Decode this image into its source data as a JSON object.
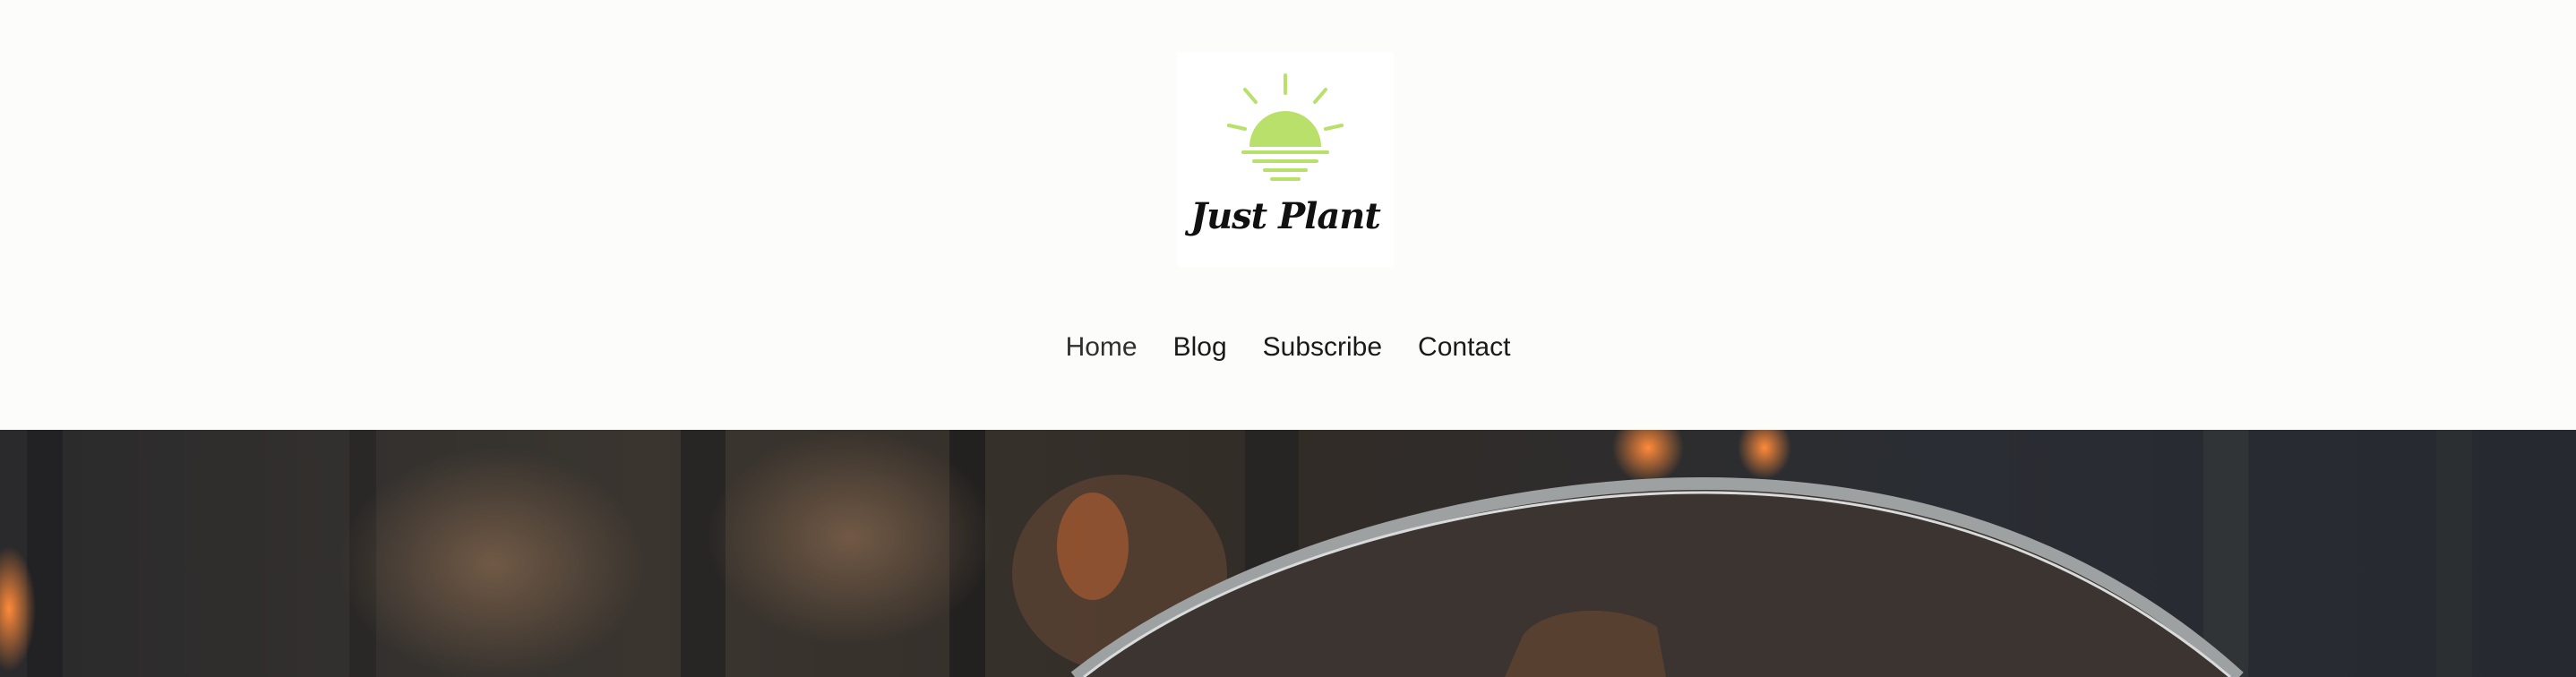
{
  "site": {
    "brand_name": "Just Plant",
    "logo_icon": "sunrise-icon",
    "accent_color": "#b9e06a"
  },
  "nav": {
    "items": [
      {
        "label": "Home"
      },
      {
        "label": "Blog"
      },
      {
        "label": "Subscribe"
      },
      {
        "label": "Contact"
      }
    ],
    "active": "Home"
  },
  "hero": {
    "image": "campfire-pot-photo"
  }
}
